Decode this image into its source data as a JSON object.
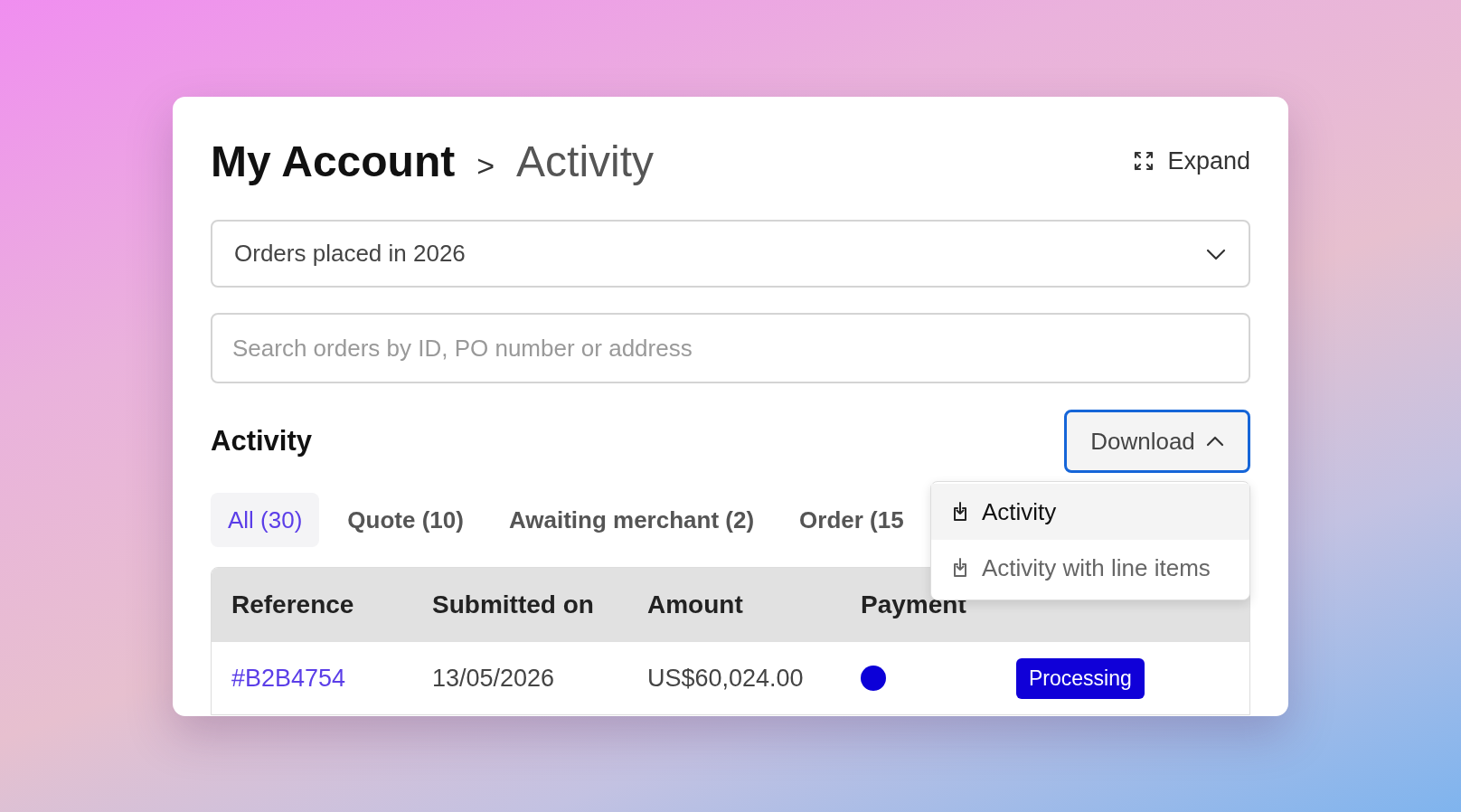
{
  "breadcrumb": {
    "parent": "My Account",
    "separator": ">",
    "current": "Activity"
  },
  "expand_button": {
    "label": "Expand"
  },
  "period_select": {
    "value": "Orders placed in 2026"
  },
  "search": {
    "placeholder": "Search orders by ID, PO number or address"
  },
  "section_title": "Activity",
  "download_button": {
    "label": "Download",
    "expanded": true
  },
  "download_menu": [
    {
      "label": "Activity",
      "highlighted": true
    },
    {
      "label": "Activity with line items",
      "highlighted": false
    }
  ],
  "tabs": [
    {
      "label": "All (30)",
      "selected": true
    },
    {
      "label": "Quote (10)",
      "selected": false
    },
    {
      "label": "Awaiting merchant (2)",
      "selected": false
    },
    {
      "label": "Order (15",
      "selected": false
    }
  ],
  "table": {
    "columns": [
      "Reference",
      "Submitted on",
      "Amount",
      "Payment"
    ],
    "rows": [
      {
        "reference": "#B2B4754",
        "submitted_on": "13/05/2026",
        "amount": "US$60,024.00",
        "payment": {
          "color": "#0c00d8"
        },
        "status": {
          "label": "Processing",
          "color": "#1000d8"
        }
      }
    ]
  }
}
